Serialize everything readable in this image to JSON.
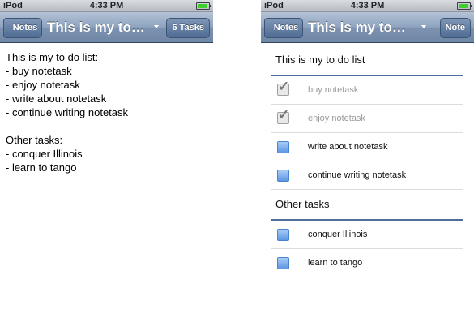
{
  "status": {
    "carrier": "iPod",
    "time": "4:33 PM",
    "battery_fraction": 0.85
  },
  "left_screen": {
    "back_button": "Notes",
    "title": "This is my to…",
    "right_button": "6 Tasks",
    "note_lines": [
      "This is my to do list:",
      "- buy notetask",
      "- enjoy notetask",
      "- write about notetask",
      "- continue writing notetask",
      "",
      "Other tasks:",
      "- conquer Illinois",
      "- learn to tango"
    ]
  },
  "right_screen": {
    "back_button": "Notes",
    "title": "This is my to…",
    "right_button": "Note",
    "sections": [
      {
        "header": "This is my to do list",
        "tasks": [
          {
            "label": "buy notetask",
            "done": true
          },
          {
            "label": "enjoy notetask",
            "done": true
          },
          {
            "label": "write about notetask",
            "done": false
          },
          {
            "label": "continue writing notetask",
            "done": false
          }
        ]
      },
      {
        "header": "Other tasks",
        "tasks": [
          {
            "label": "conquer Illinois",
            "done": false
          },
          {
            "label": "learn to tango",
            "done": false
          }
        ]
      }
    ]
  },
  "icons": {
    "done": "checkmark-icon",
    "pending": "checkbox-icon",
    "back": "back-arrow-button",
    "dropdown": "chevron-down-icon"
  },
  "colors": {
    "nav_bar": "#7d93b1",
    "section_rule": "#4f6e99",
    "checkbox_blue": "#5d97e4",
    "battery": "#3ecf2f"
  }
}
